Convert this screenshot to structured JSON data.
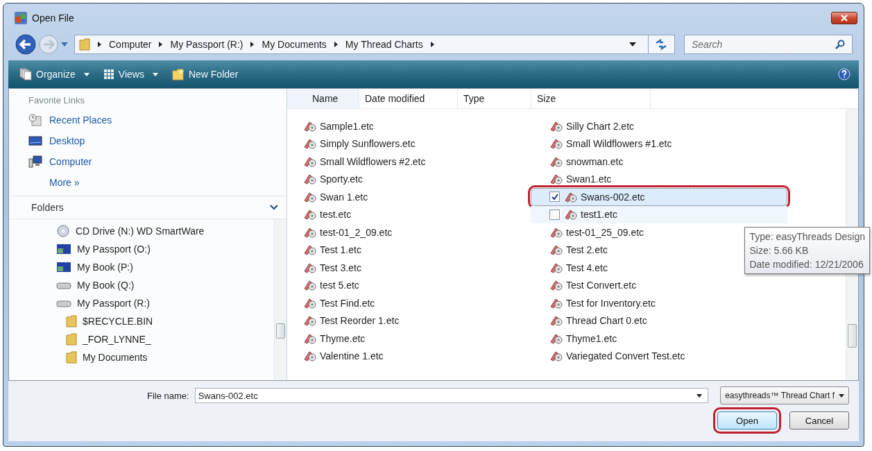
{
  "window": {
    "title": "Open File"
  },
  "address_bar": {
    "path": [
      "Computer",
      "My Passport (R:)",
      "My Documents",
      "My Thread Charts"
    ]
  },
  "search": {
    "placeholder": "Search"
  },
  "toolbar": [
    {
      "label": "Organize",
      "kind": "organize",
      "dropdown": true
    },
    {
      "label": "Views",
      "kind": "views",
      "dropdown": true
    },
    {
      "label": "New Folder",
      "kind": "new-folder",
      "dropdown": false
    }
  ],
  "favorite_links": {
    "title": "Favorite Links",
    "items": [
      {
        "label": "Recent Places",
        "kind": "recent"
      },
      {
        "label": "Desktop",
        "kind": "desktop"
      },
      {
        "label": "Computer",
        "kind": "computer"
      }
    ],
    "more": "More »"
  },
  "folders": {
    "title": "Folders",
    "tree": [
      {
        "label": "CD Drive (N:) WD SmartWare",
        "kind": "cd"
      },
      {
        "label": "My Passport (O:)",
        "kind": "passport"
      },
      {
        "label": "My Book (P:)",
        "kind": "passport"
      },
      {
        "label": "My Book (Q:)",
        "kind": "drive"
      },
      {
        "label": "My Passport (R:)",
        "kind": "drive",
        "children": [
          {
            "label": "$RECYCLE.BIN",
            "kind": "folder"
          },
          {
            "label": "_FOR_LYNNE_",
            "kind": "folder"
          },
          {
            "label": "My Documents",
            "kind": "folder"
          }
        ]
      }
    ]
  },
  "columns": [
    "Name",
    "Date modified",
    "Type",
    "Size"
  ],
  "file_columns": [
    [
      {
        "name": "Sample1.etc",
        "selected": false,
        "hovered": false,
        "highlighted": false
      },
      {
        "name": "Simply Sunflowers.etc",
        "selected": false,
        "hovered": false,
        "highlighted": false
      },
      {
        "name": "Small Wildflowers #2.etc",
        "selected": false,
        "hovered": false,
        "highlighted": false
      },
      {
        "name": "Sporty.etc",
        "selected": false,
        "hovered": false,
        "highlighted": false
      },
      {
        "name": "Swan 1.etc",
        "selected": false,
        "hovered": false,
        "highlighted": false
      },
      {
        "name": "test.etc",
        "selected": false,
        "hovered": false,
        "highlighted": false
      },
      {
        "name": "test-01_2_09.etc",
        "selected": false,
        "hovered": false,
        "highlighted": false
      },
      {
        "name": "Test 1.etc",
        "selected": false,
        "hovered": false,
        "highlighted": false
      },
      {
        "name": "Test 3.etc",
        "selected": false,
        "hovered": false,
        "highlighted": false
      },
      {
        "name": "test 5.etc",
        "selected": false,
        "hovered": false,
        "highlighted": false
      },
      {
        "name": "Test Find.etc",
        "selected": false,
        "hovered": false,
        "highlighted": false
      },
      {
        "name": "Test Reorder 1.etc",
        "selected": false,
        "hovered": false,
        "highlighted": false
      },
      {
        "name": "Thyme.etc",
        "selected": false,
        "hovered": false,
        "highlighted": false
      },
      {
        "name": "Valentine 1.etc",
        "selected": false,
        "hovered": false,
        "highlighted": false
      }
    ],
    [
      {
        "name": "Silly Chart 2.etc",
        "selected": false,
        "hovered": false,
        "highlighted": false
      },
      {
        "name": "Small Wildflowers #1.etc",
        "selected": false,
        "hovered": false,
        "highlighted": false
      },
      {
        "name": "snowman.etc",
        "selected": false,
        "hovered": false,
        "highlighted": false
      },
      {
        "name": "Swan1.etc",
        "selected": false,
        "hovered": false,
        "highlighted": false
      },
      {
        "name": "Swans-002.etc",
        "selected": true,
        "hovered": false,
        "highlighted": true,
        "checked": true
      },
      {
        "name": "test1.etc",
        "selected": false,
        "hovered": true,
        "highlighted": false,
        "checked": false
      },
      {
        "name": "test-01_25_09.etc",
        "selected": false,
        "hovered": false,
        "highlighted": false
      },
      {
        "name": "Test 2.etc",
        "selected": false,
        "hovered": false,
        "highlighted": false
      },
      {
        "name": "Test 4.etc",
        "selected": false,
        "hovered": false,
        "highlighted": false
      },
      {
        "name": "Test Convert.etc",
        "selected": false,
        "hovered": false,
        "highlighted": false
      },
      {
        "name": "Test for Inventory.etc",
        "selected": false,
        "hovered": false,
        "highlighted": false
      },
      {
        "name": "Thread Chart 0.etc",
        "selected": false,
        "hovered": false,
        "highlighted": false
      },
      {
        "name": "Thyme1.etc",
        "selected": false,
        "hovered": false,
        "highlighted": false
      },
      {
        "name": "Variegated Convert Test.etc",
        "selected": false,
        "hovered": false,
        "highlighted": false
      }
    ]
  ],
  "tooltip": {
    "lines": [
      "Type: easyThreads Design",
      "Size: 5.66 KB",
      "Date modified: 12/21/2006"
    ]
  },
  "file_name": {
    "label": "File name:",
    "value": "Swans-002.etc"
  },
  "file_type": {
    "value": "easythreads™ Thread Chart f"
  },
  "buttons": [
    {
      "label": "Open",
      "highlighted": true
    },
    {
      "label": "Cancel",
      "highlighted": false
    }
  ]
}
